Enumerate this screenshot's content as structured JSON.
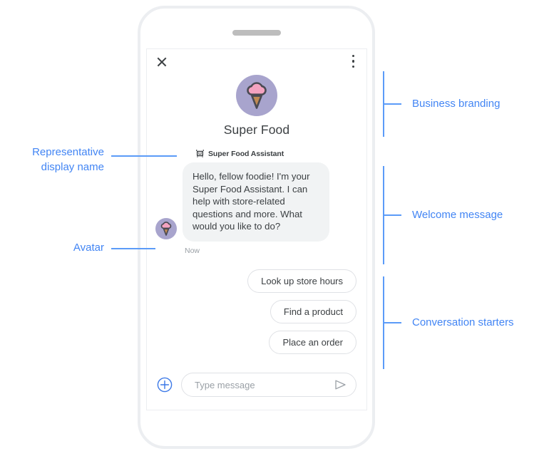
{
  "meta": {
    "accent_color": "#4285f4",
    "bracket_color": "#5b9bf8",
    "avatar_circle_color": "#a8a4cd",
    "avatar_scoop_color": "#f4a3c0",
    "avatar_cone_color": "#c08a52",
    "bubble_color": "#f1f3f4",
    "text_color": "#3c4043"
  },
  "phone": {
    "speaker_name": "phone-speaker"
  },
  "chat": {
    "topbar": {
      "close_label": "close-icon",
      "menu_label": "overflow-menu-icon"
    },
    "branding": {
      "avatar_icon": "ice-cream-avatar-icon",
      "business_name": "Super Food"
    },
    "representative": {
      "bot_icon": "robot-face-icon",
      "display_name": "Super Food Assistant"
    },
    "welcome": {
      "avatar_icon": "ice-cream-avatar-icon",
      "text": "Hello, fellow foodie! I'm your Super Food Assistant. I can help with store-related questions and more. What would you like to do?",
      "timestamp": "Now"
    },
    "starters": [
      {
        "label": "Look up store hours"
      },
      {
        "label": "Find a product"
      },
      {
        "label": "Place an order"
      }
    ],
    "composer": {
      "plus_icon": "add-attachment-icon",
      "input_value": "",
      "input_placeholder": "Type message",
      "send_icon": "send-icon"
    }
  },
  "annotations": {
    "left": [
      {
        "id": "representative-display-name",
        "label": "Representative\ndisplay name"
      },
      {
        "id": "avatar",
        "label": "Avatar"
      }
    ],
    "right": [
      {
        "id": "business-branding",
        "label": "Business branding"
      },
      {
        "id": "welcome-message",
        "label": "Welcome message"
      },
      {
        "id": "conversation-starters",
        "label": "Conversation starters"
      }
    ]
  }
}
